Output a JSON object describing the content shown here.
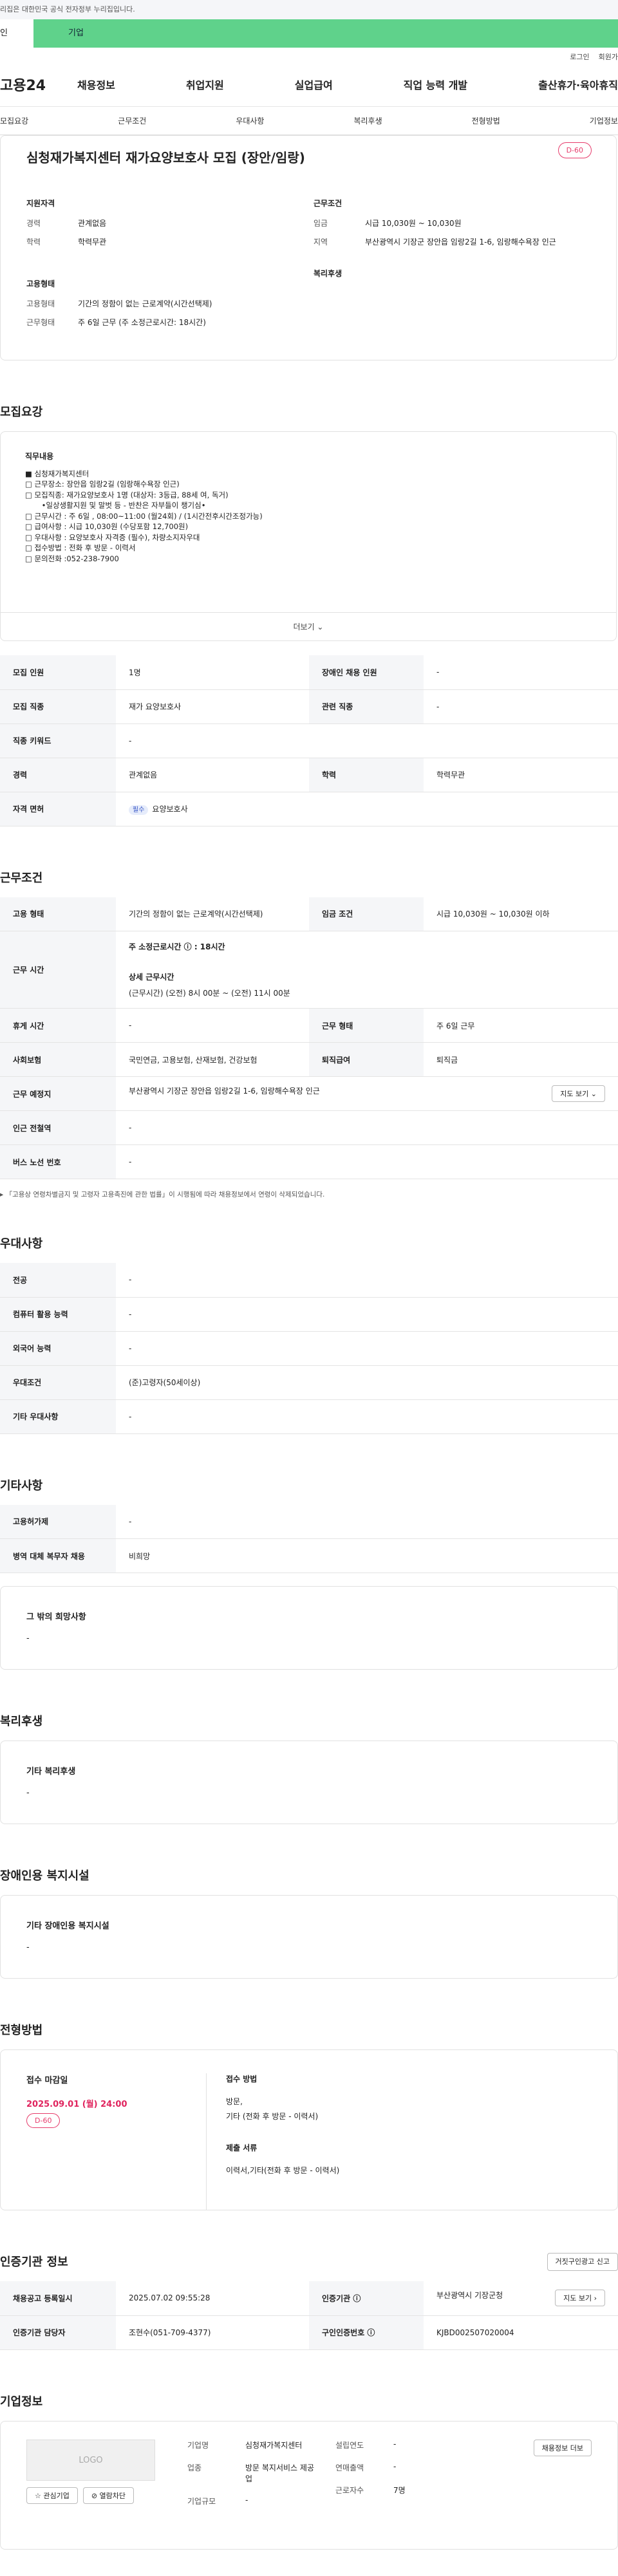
{
  "gov_banner": "리집은 대한민국 공식 전자정부 누리집입니다.",
  "tabs": {
    "t1": "인",
    "t2": "기업"
  },
  "util": {
    "login": "로그인",
    "join": "회원가"
  },
  "gnb": {
    "logo": "고용24",
    "menu": [
      "채용정보",
      "취업지원",
      "실업급여",
      "직업 능력 개발",
      "출산휴가·육아휴직"
    ]
  },
  "anchor": [
    "모집요강",
    "근무조건",
    "우대사항",
    "복리후생",
    "전형방법",
    "기업정보"
  ],
  "title": "심청재가복지센터 재가요양보호사 모집 (장안/임랑)",
  "dday": "D-60",
  "summary": {
    "left_h": "지원자격",
    "left": [
      {
        "k": "경력",
        "v": "관계없음"
      },
      {
        "k": "학력",
        "v": "학력무관"
      }
    ],
    "right_h": "근무조건",
    "right": [
      {
        "k": "임금",
        "v": "시급 10,030원 ~ 10,030원"
      },
      {
        "k": "지역",
        "v": "부산광역시 기장군 장안읍 임랑2길 1-6, 임랑해수욕장 인근"
      }
    ],
    "emp_h": "고용형태",
    "emp": [
      {
        "k": "고용형태",
        "v": "기간의 정함이 없는 근로계약(시간선택제)"
      },
      {
        "k": "근무형태",
        "v": "주 6일 근무 (주 소정근로시간: 18시간)"
      }
    ],
    "welfare_h": "복리후생"
  },
  "sec_recruit": "모집요강",
  "duty_title": "직무내용",
  "duty_lines": [
    "■ 심청재가복지센터",
    "□ 근무장소: 장안읍 임랑2길 (임랑해수욕장 인근)",
    "□ 모집직종: 재가요양보호사 1명 (대상자: 3등급, 88세 여, 독거)",
    "       •일상생활지원 및 말벗 등 - 반찬은 자부들이 챙기심•",
    "□ 근무시간 : 주 6일 , 08:00~11:00 (월24회) / (1시간전후시간조정가능)",
    "□ 급여사항 : 시급 10,030원 (수당포함 12,700원)",
    "□ 우대사항 : 요양보호사 자격증 (필수), 차량소지자우대",
    "□ 접수방법 : 전화 후 방문 - 이력서",
    "□ 문의전화 :052-238-7900"
  ],
  "more": "더보기 ⌄",
  "recruit_table": {
    "r1": [
      "모집 인원",
      "1명",
      "장애인 채용 인원",
      "-"
    ],
    "r2": [
      "모집 직종",
      "재가 요양보호사",
      "관련 직종",
      "-"
    ],
    "r3": [
      "직종 키워드",
      "-"
    ],
    "r4": [
      "경력",
      "관계없음",
      "학력",
      "학력무관"
    ],
    "r5": [
      "자격 면허",
      "필수",
      "요양보호사"
    ]
  },
  "sec_cond": "근무조건",
  "cond": {
    "emp": [
      "고용 형태",
      "기간의 정함이 없는 근로계약(시간선택제)",
      "임금 조건",
      "시급 10,030원 ~ 10,030원 이하"
    ],
    "worktime_k": "근무 시간",
    "wt1": "주 소정근로시간 ⓘ : 18시간",
    "wt2": "상세 근무시간",
    "wt3": "(근무시간) (오전) 8시 00분 ~ (오전) 11시 00분",
    "holiday": [
      "휴게 시간",
      "-",
      "근무 형태",
      "주 6일 근무"
    ],
    "ins": [
      "사회보험",
      "국민연금, 고용보험, 산재보험, 건강보험",
      "퇴직급여",
      "퇴직금"
    ],
    "place": [
      "근무 예정지",
      "부산광역시 기장군 장안읍 임랑2길 1-6, 임랑해수욕장 인근",
      "지도 보기 ⌄"
    ],
    "subway": [
      "인근 전철역",
      "-"
    ],
    "bus": [
      "버스 노선 번호",
      "-"
    ]
  },
  "cond_note": "▸ 「고용상 연령차별금지 및 고령자 고용촉진에 관한 법률」이 시행됨에 따라 채용정보에서 연령이 삭제되었습니다.",
  "sec_pref": "우대사항",
  "pref": [
    [
      "전공",
      "-"
    ],
    [
      "컴퓨터 활용 능력",
      "-"
    ],
    [
      "외국어 능력",
      "-"
    ],
    [
      "우대조건",
      "(준)고령자(50세이상)"
    ],
    [
      "기타 우대사항",
      "-"
    ]
  ],
  "sec_etc": "기타사항",
  "etc": [
    [
      "고용허가제",
      "-"
    ],
    [
      "병역 대체 복무자 채용",
      "비희망"
    ]
  ],
  "etc_box": {
    "t": "그 밖의 희망사항",
    "v": "-"
  },
  "sec_welfare": "복리후생",
  "welfare_box": {
    "t": "기타 복리후생",
    "v": "-"
  },
  "sec_disab": "장애인용 복지시설",
  "disab_box": {
    "t": "기타 장애인용 복지시설",
    "v": "-"
  },
  "sec_proc": "전형방법",
  "proc": {
    "deadline_h": "접수 마감일",
    "deadline": "2025.09.01 (월) 24:00",
    "dday": "D-60",
    "method_h": "접수 방법",
    "method": "방문,",
    "method2": "기타 (전화 후 방문 - 이력서)",
    "docs_h": "제출 서류",
    "docs": "이력서,기타(전화 후 방문 - 이력서)"
  },
  "sec_agency": "인증기관 정보",
  "agency_btn": "거짓구인광고 신고",
  "agency": {
    "r1": [
      "채용공고 등록일시",
      "2025.07.02 09:55:28",
      "인증기관 ⓘ",
      "부산광역시 기장군청",
      "지도 보기 ›"
    ],
    "r2": [
      "인증기관 담당자",
      "조현수(051-709-4377)",
      "구인인증번호 ⓘ",
      "KJBD002507020004"
    ]
  },
  "sec_company": "기업정보",
  "company": {
    "logo": "LOGO",
    "fav": "☆ 관심기업",
    "block": "⊘ 열람차단",
    "name_k": "기업명",
    "name": "심청재가복지센터",
    "ind_k": "업종",
    "ind": "방문 복지서비스 제공업",
    "size_k": "기업규모",
    "size": "-",
    "year_k": "설립연도",
    "year": "-",
    "sales_k": "연매출액",
    "sales": "-",
    "emp_k": "근로자수",
    "emp": "7명",
    "btn": "채용정보 더보"
  }
}
